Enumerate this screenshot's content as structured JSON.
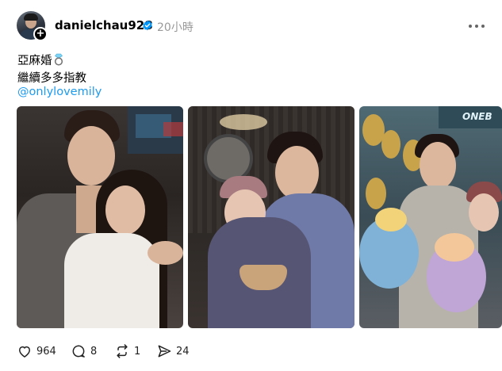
{
  "post": {
    "username": "danielchau928",
    "time": "20小時",
    "caption_line1": "亞麻婚",
    "caption_line2": "繼續多多指教",
    "mention": "@onlylovemily",
    "verified_color": "#0095f6",
    "mention_color": "#1d9bf0",
    "images": [
      {
        "alt": "couple-photo-hug"
      },
      {
        "alt": "couple-photo-cake"
      },
      {
        "alt": "couple-photo-flowers",
        "sign_text": "ONEB"
      }
    ]
  },
  "actions": {
    "likes": "964",
    "comments": "8",
    "reposts": "1",
    "shares": "24"
  }
}
